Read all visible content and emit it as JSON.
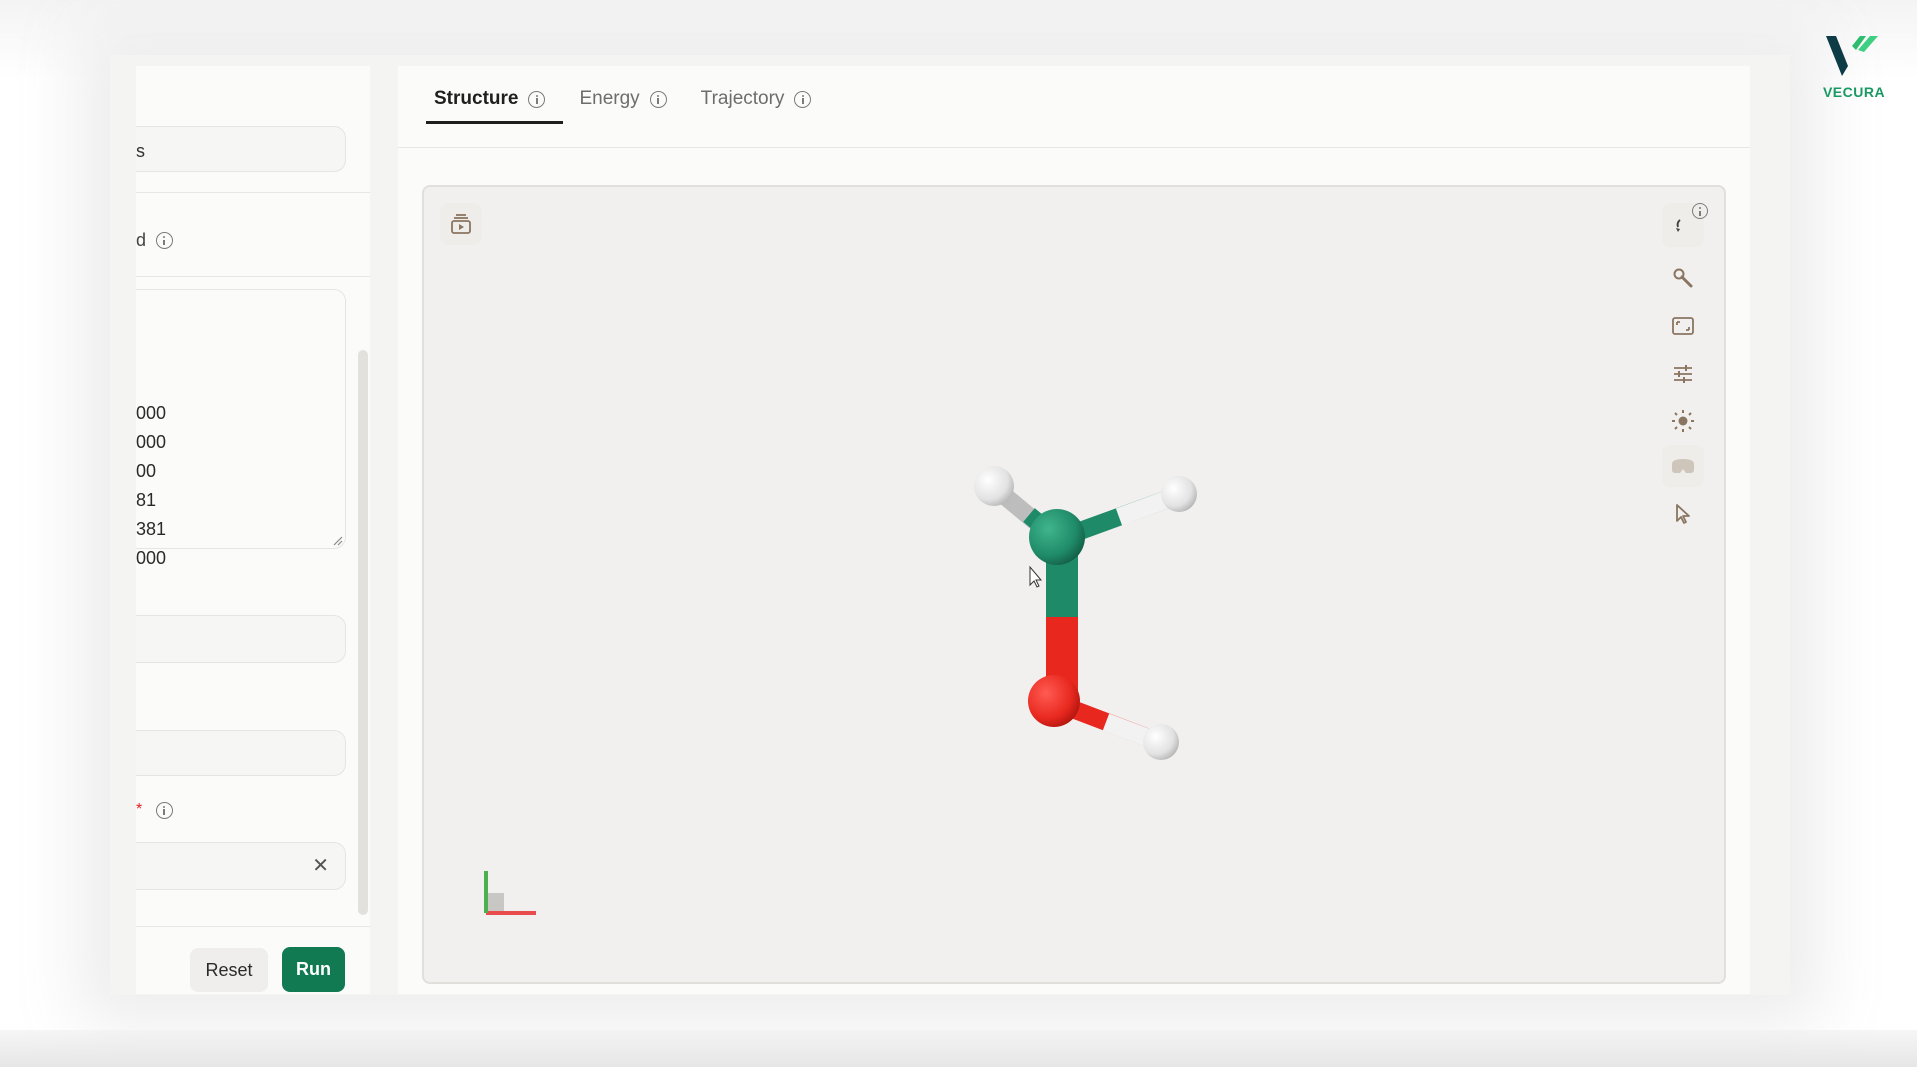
{
  "brand": {
    "name": "VECURA",
    "primary_color": "#0d3b46",
    "accent_color": "#2ebd6f"
  },
  "left_panel": {
    "field1_value": "s",
    "label2": "d",
    "coordinates": [
      "000",
      "000",
      "00",
      "81",
      "381",
      "000"
    ],
    "label_required_marker": "*",
    "clear_icon": "✕",
    "reset_label": "Reset",
    "run_label": "Run"
  },
  "tabs": [
    {
      "label": "Structure",
      "active": true
    },
    {
      "label": "Energy",
      "active": false
    },
    {
      "label": "Trajectory",
      "active": false
    }
  ],
  "viewer": {
    "tools": [
      "rotate-icon",
      "wrench-icon",
      "screenshot-icon",
      "sliders-icon",
      "light-icon",
      "vr-headset-icon",
      "pointer-icon"
    ],
    "atom_colors": {
      "carbon": "#1f8a68",
      "oxygen": "#e8281f",
      "hydrogen": "#f0f0f0"
    },
    "axis_colors": {
      "x": "#e84c4c",
      "y": "#4caf50"
    }
  }
}
